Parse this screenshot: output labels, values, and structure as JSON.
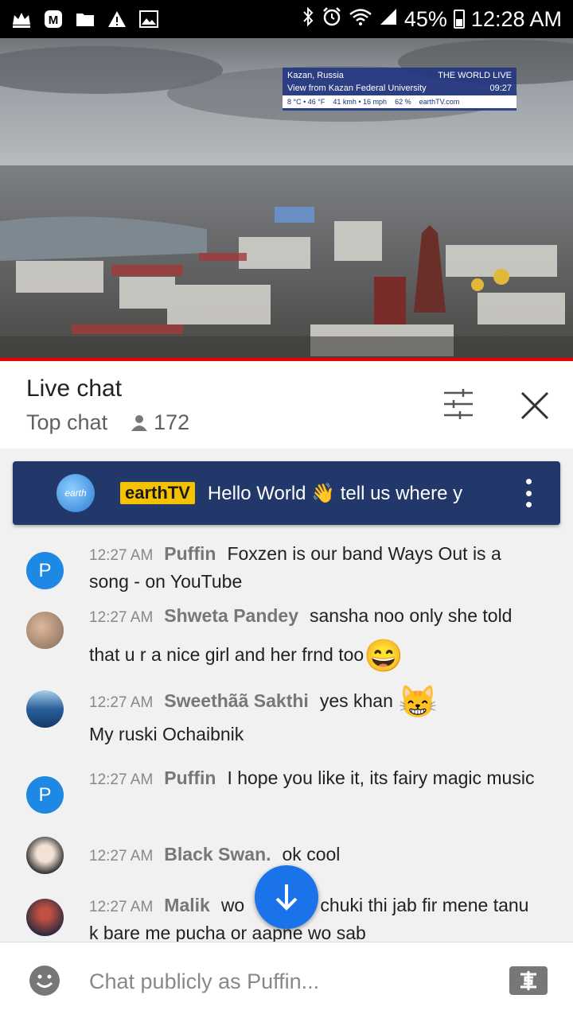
{
  "status_bar": {
    "battery": "45%",
    "time": "12:28 AM",
    "left_icons": [
      "crown-icon",
      "m-app-icon",
      "folder-icon",
      "warning-icon",
      "image-icon"
    ],
    "right_icons": [
      "bluetooth-icon",
      "alarm-icon",
      "wifi-icon",
      "signal-icon",
      "battery-icon"
    ]
  },
  "video": {
    "overlay_location": "Kazan, Russia",
    "overlay_brand": "THE WORLD LIVE",
    "overlay_view": "View from Kazan Federal University",
    "overlay_time": "09:27",
    "overlay_temp": "8 °C • 46 °F",
    "overlay_wind": "41 kmh • 16 mph",
    "overlay_humidity": "62 %",
    "overlay_site": "earthTV.com"
  },
  "header": {
    "title": "Live chat",
    "subtitle": "Top chat",
    "viewer_count": "172"
  },
  "pinned": {
    "avatar_text": "earth",
    "author": "earthTV",
    "message": "Hello World 👋 tell us where y"
  },
  "messages": [
    {
      "time": "12:27 AM",
      "author": "Puffin",
      "text": "Foxzen is our band Ways Out is a song - on YouTube",
      "avatar": "P"
    },
    {
      "time": "12:27 AM",
      "author": "Shweta Pandey",
      "text": "sansha noo only she told that u r a nice girl and her frnd too",
      "emoji": "😄"
    },
    {
      "time": "12:27 AM",
      "author": "Sweethãã Sakthi",
      "text": "yes khan",
      "emoji": "😸",
      "text2": "My ruski Ochaibnik"
    },
    {
      "time": "12:27 AM",
      "author": "Puffin",
      "text": "I hope you like it, its fairy magic music",
      "avatar": "P"
    },
    {
      "time": "12:27 AM",
      "author": "Black Swan.",
      "text": "ok cool"
    },
    {
      "time": "12:27 AM",
      "author": "Malik",
      "text": "wo",
      "text_after": "e ho chuki thi jab fir mene tanu k bare me pucha or aapne wo sab"
    }
  ],
  "input": {
    "placeholder": "Chat publicly as Puffin..."
  },
  "colors": {
    "accent_blue": "#1a73e8",
    "pinned_bg": "#22386b",
    "badge_yellow": "#f5c200",
    "progress_red": "#ee0000"
  }
}
